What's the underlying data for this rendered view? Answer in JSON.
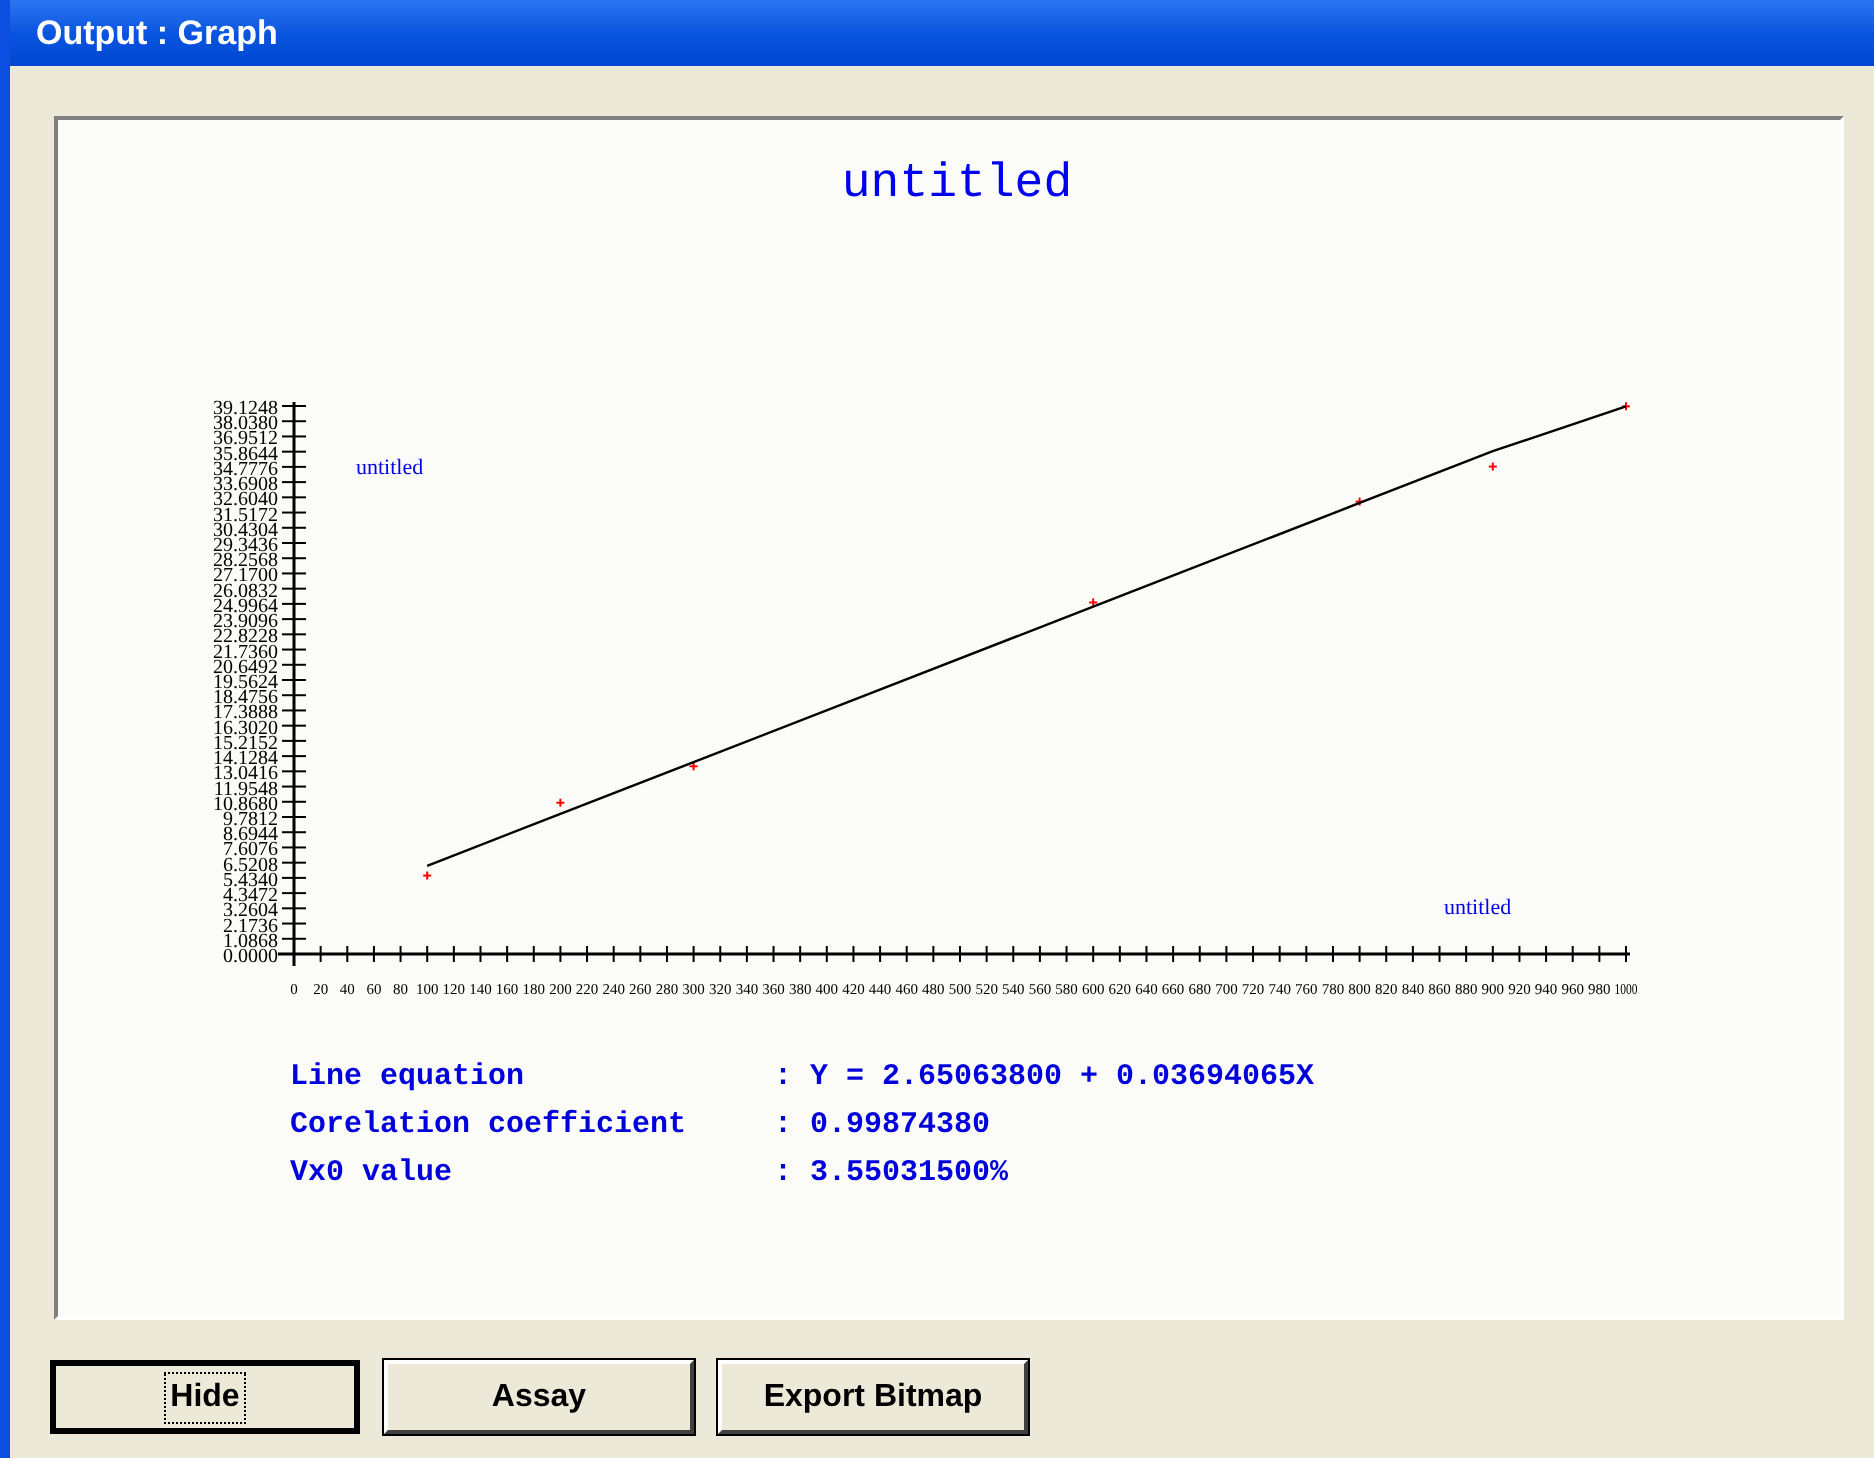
{
  "window": {
    "title": "Output : Graph"
  },
  "graph": {
    "chart_data": {
      "type": "scatter",
      "title": "untitled",
      "xlabel": "untitled",
      "ylabel": "untitled",
      "x": [
        100,
        200,
        300,
        600,
        800,
        900,
        1000
      ],
      "series": [
        {
          "type": "scatter",
          "color": "#ff0000",
          "values": [
            5.6,
            10.8,
            13.4,
            25.1,
            32.3,
            34.8,
            39.1
          ]
        },
        {
          "type": "line",
          "color": "#000000",
          "values": [
            6.3,
            10.0,
            13.7,
            24.8,
            32.2,
            35.9,
            39.1
          ]
        }
      ],
      "xlim": [
        0,
        1000
      ],
      "ylim": [
        0,
        39.1248
      ],
      "xticks": [
        0,
        20,
        40,
        60,
        80,
        100,
        120,
        140,
        160,
        180,
        200,
        220,
        240,
        260,
        280,
        300,
        320,
        340,
        360,
        380,
        400,
        420,
        440,
        460,
        480,
        500,
        520,
        540,
        560,
        580,
        600,
        620,
        640,
        660,
        680,
        700,
        720,
        740,
        760,
        780,
        800,
        820,
        840,
        860,
        880,
        900,
        920,
        940,
        960,
        980,
        1000
      ],
      "yticks": [
        {
          "value": 0,
          "label": "0.0000"
        },
        {
          "value": 1.0868,
          "label": "1.0868"
        },
        {
          "value": 2.1736,
          "label": "2.1736"
        },
        {
          "value": 3.2604,
          "label": "3.2604"
        },
        {
          "value": 4.3472,
          "label": "4.3472"
        },
        {
          "value": 5.434,
          "label": "5.4340"
        },
        {
          "value": 6.5208,
          "label": "6.5208"
        },
        {
          "value": 7.6076,
          "label": "7.6076"
        },
        {
          "value": 8.6944,
          "label": "8.6944"
        },
        {
          "value": 9.7812,
          "label": "9.7812"
        },
        {
          "value": 10.868,
          "label": "10.8680"
        },
        {
          "value": 11.9548,
          "label": "11.9548"
        },
        {
          "value": 13.0416,
          "label": "13.0416"
        },
        {
          "value": 14.1284,
          "label": "14.1284"
        },
        {
          "value": 15.2152,
          "label": "15.2152"
        },
        {
          "value": 16.302,
          "label": "16.3020"
        },
        {
          "value": 17.3888,
          "label": "17.3888"
        },
        {
          "value": 18.4756,
          "label": "18.4756"
        },
        {
          "value": 19.5624,
          "label": "19.5624"
        },
        {
          "value": 20.6492,
          "label": "20.6492"
        },
        {
          "value": 21.736,
          "label": "21.7360"
        },
        {
          "value": 22.8228,
          "label": "22.8228"
        },
        {
          "value": 23.9096,
          "label": "23.9096"
        },
        {
          "value": 24.9964,
          "label": "24.9964"
        },
        {
          "value": 26.0832,
          "label": "26.0832"
        },
        {
          "value": 27.17,
          "label": "27.1700"
        },
        {
          "value": 28.2568,
          "label": "28.2568"
        },
        {
          "value": 29.3436,
          "label": "29.3436"
        },
        {
          "value": 30.4304,
          "label": "30.4304"
        },
        {
          "value": 31.5172,
          "label": "31.5172"
        },
        {
          "value": 32.604,
          "label": "32.6040"
        },
        {
          "value": 33.6908,
          "label": "33.6908"
        },
        {
          "value": 34.7776,
          "label": "34.7776"
        },
        {
          "value": 35.8644,
          "label": "35.8644"
        },
        {
          "value": 36.9512,
          "label": "36.9512"
        },
        {
          "value": 38.038,
          "label": "38.0380"
        },
        {
          "value": 39.1248,
          "label": "39.1248"
        }
      ]
    }
  },
  "results": [
    {
      "label": "Line equation",
      "value": ": Y = 2.65063800 + 0.03694065X"
    },
    {
      "label": "Corelation coefficient",
      "value": ": 0.99874380"
    },
    {
      "label": "Vx0 value",
      "value": ": 3.55031500%"
    }
  ],
  "buttons": [
    {
      "label": "Hide",
      "default": true
    },
    {
      "label": "Assay",
      "default": false
    },
    {
      "label": "Export Bitmap",
      "default": false
    }
  ]
}
